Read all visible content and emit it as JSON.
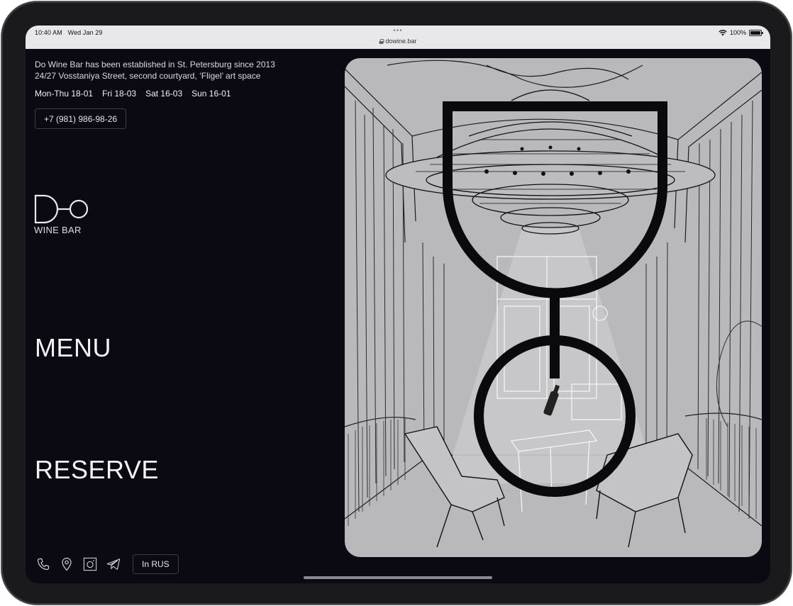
{
  "status_bar": {
    "time": "10:40 AM",
    "date": "Wed Jan 29",
    "url": "dowine.bar",
    "battery": "100%",
    "battery_level": 1.0
  },
  "info": {
    "line1": "Do Wine Bar has been established in St. Petersburg since 2013",
    "line2": "24/27 Vosstaniya Street, second courtyard, ‘Fligel’ art space"
  },
  "hours": [
    "Mon-Thu 18-01",
    "Fri 18-03",
    "Sat 16-03",
    "Sun 16-01"
  ],
  "phone": "+7 (981) 986-98-26",
  "logo": {
    "mark": "Do",
    "subtitle": "WINE BAR"
  },
  "nav": {
    "menu": "MENU",
    "reserve": "RESERVE"
  },
  "footer": {
    "icons": [
      "phone-icon",
      "location-pin-icon",
      "instagram-icon",
      "telegram-icon"
    ],
    "language_button": "In RUS"
  },
  "colors": {
    "background": "#0b0a12",
    "text": "#f2f2f6",
    "hero_background": "#b9b9bb",
    "button_border": "#3c3b46"
  }
}
